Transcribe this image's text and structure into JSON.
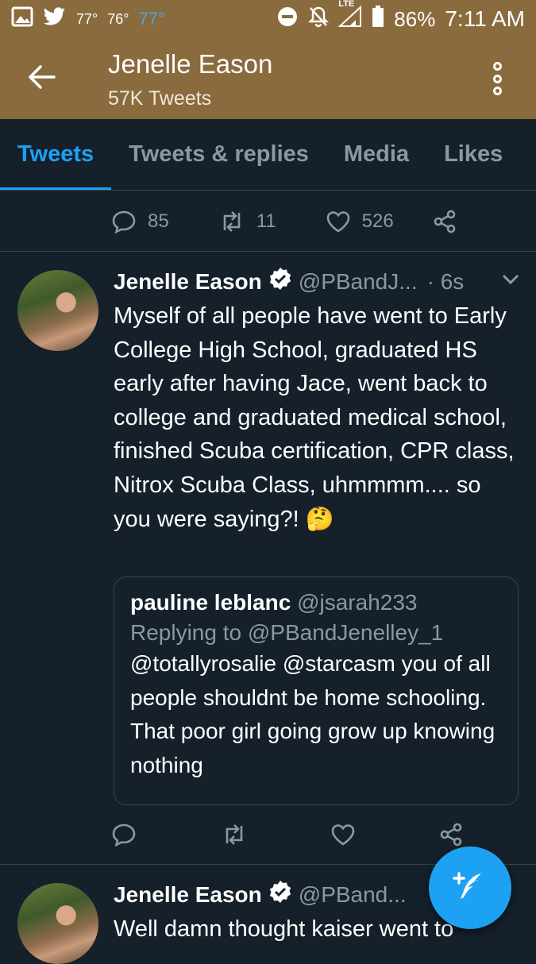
{
  "status_bar": {
    "temp1": "77°",
    "temp2": "76°",
    "temp3": "77°",
    "network": "LTE",
    "battery": "86%",
    "time": "7:11 AM",
    "icons": [
      "gallery-icon",
      "twitter-icon",
      "minus-circle-icon",
      "bell-off-icon",
      "signal-icon",
      "battery-icon"
    ]
  },
  "header": {
    "title": "Jenelle Eason",
    "subtitle": "57K Tweets"
  },
  "tabs": [
    {
      "label": "Tweets",
      "active": true
    },
    {
      "label": "Tweets & replies",
      "active": false
    },
    {
      "label": "Media",
      "active": false
    },
    {
      "label": "Likes",
      "active": false
    }
  ],
  "prev_tweet_actions": {
    "replies": "85",
    "retweets": "11",
    "likes": "526"
  },
  "tweet1": {
    "name": "Jenelle Eason",
    "handle": "@PBandJ...",
    "time": "· 6s",
    "text": "Myself of all people have went to Early College High School, graduated HS early after having Jace, went back to college and graduated medical school, finished Scuba certification, CPR class, Nitrox Scuba Class, uhmmmm.... so you were saying?! 🤔",
    "quote": {
      "name": "pauline leblanc",
      "handle": "@jsarah233",
      "reply_to": "Replying to @PBandJenelley_1",
      "text": "@totallyrosalie @starcasm you of all people shouldnt be home schooling. That poor girl going grow up knowing nothing"
    }
  },
  "tweet2": {
    "name": "Jenelle Eason",
    "handle": "@PBand...",
    "text": "Well damn thought kaiser went to"
  },
  "colors": {
    "accent": "#1da1f2",
    "header_bg": "#8a6b3e",
    "page_bg": "#15202b",
    "muted": "#8899a6"
  }
}
